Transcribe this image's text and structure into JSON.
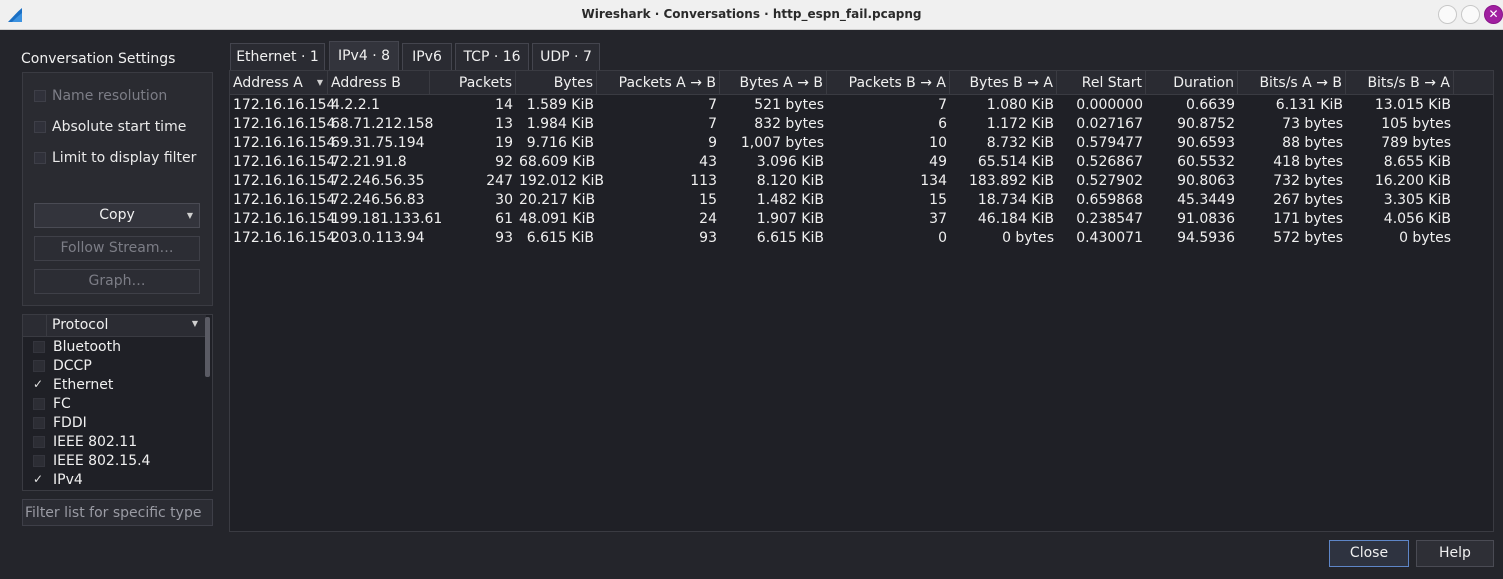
{
  "window": {
    "title": "Wireshark · Conversations · http_espn_fail.pcapng",
    "close_glyph": "✕"
  },
  "settings": {
    "title": "Conversation Settings",
    "name_resolution": "Name resolution",
    "absolute_start_time": "Absolute start time",
    "limit_to_display_filter": "Limit to display filter",
    "copy": "Copy",
    "follow_stream": "Follow Stream…",
    "graph": "Graph…"
  },
  "protocols": {
    "header": "Protocol",
    "items": [
      {
        "label": "Bluetooth",
        "check": ""
      },
      {
        "label": "DCCP",
        "check": ""
      },
      {
        "label": "Ethernet",
        "check": "✓"
      },
      {
        "label": "FC",
        "check": ""
      },
      {
        "label": "FDDI",
        "check": ""
      },
      {
        "label": "IEEE 802.11",
        "check": ""
      },
      {
        "label": "IEEE 802.15.4",
        "check": ""
      },
      {
        "label": "IPv4",
        "check": "✓"
      }
    ],
    "filter_placeholder": "Filter list for specific type"
  },
  "tabs": [
    {
      "label": "Ethernet · 1"
    },
    {
      "label": "IPv4 · 8"
    },
    {
      "label": "IPv6"
    },
    {
      "label": "TCP · 16"
    },
    {
      "label": "UDP · 7"
    }
  ],
  "table": {
    "columns": [
      "Address A",
      "Address B",
      "Packets",
      "Bytes",
      "Packets A → B",
      "Bytes A → B",
      "Packets B → A",
      "Bytes B → A",
      "Rel Start",
      "Duration",
      "Bits/s A → B",
      "Bits/s B → A"
    ],
    "rows": [
      [
        "172.16.16.154",
        "4.2.2.1",
        "14",
        "1.589 KiB",
        "7",
        "521 bytes",
        "7",
        "1.080 KiB",
        "0.000000",
        "0.6639",
        "6.131 KiB",
        "13.015 KiB"
      ],
      [
        "172.16.16.154",
        "68.71.212.158",
        "13",
        "1.984 KiB",
        "7",
        "832 bytes",
        "6",
        "1.172 KiB",
        "0.027167",
        "90.8752",
        "73 bytes",
        "105 bytes"
      ],
      [
        "172.16.16.154",
        "69.31.75.194",
        "19",
        "9.716 KiB",
        "9",
        "1,007 bytes",
        "10",
        "8.732 KiB",
        "0.579477",
        "90.6593",
        "88 bytes",
        "789 bytes"
      ],
      [
        "172.16.16.154",
        "72.21.91.8",
        "92",
        "68.609 KiB",
        "43",
        "3.096 KiB",
        "49",
        "65.514 KiB",
        "0.526867",
        "60.5532",
        "418 bytes",
        "8.655 KiB"
      ],
      [
        "172.16.16.154",
        "72.246.56.35",
        "247",
        "192.012 KiB",
        "113",
        "8.120 KiB",
        "134",
        "183.892 KiB",
        "0.527902",
        "90.8063",
        "732 bytes",
        "16.200 KiB"
      ],
      [
        "172.16.16.154",
        "72.246.56.83",
        "30",
        "20.217 KiB",
        "15",
        "1.482 KiB",
        "15",
        "18.734 KiB",
        "0.659868",
        "45.3449",
        "267 bytes",
        "3.305 KiB"
      ],
      [
        "172.16.16.154",
        "199.181.133.61",
        "61",
        "48.091 KiB",
        "24",
        "1.907 KiB",
        "37",
        "46.184 KiB",
        "0.238547",
        "91.0836",
        "171 bytes",
        "4.056 KiB"
      ],
      [
        "172.16.16.154",
        "203.0.113.94",
        "93",
        "6.615 KiB",
        "93",
        "6.615 KiB",
        "0",
        "0 bytes",
        "0.430071",
        "94.5936",
        "572 bytes",
        "0 bytes"
      ]
    ]
  },
  "footer": {
    "close": "Close",
    "help": "Help"
  }
}
